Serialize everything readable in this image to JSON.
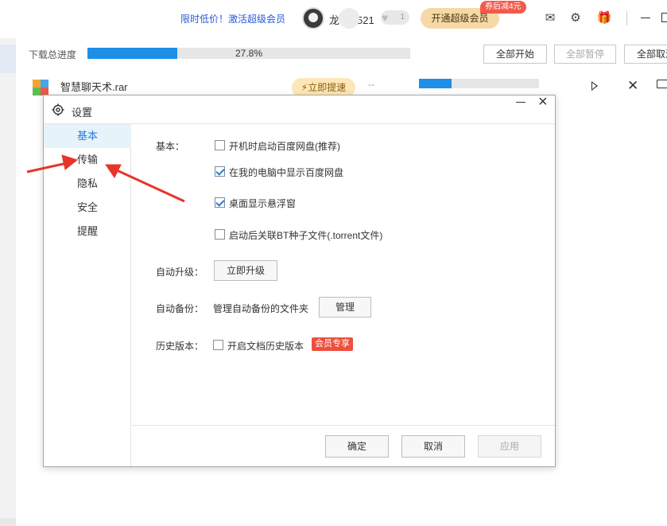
{
  "topbar": {
    "promo_text": "限时低价！激活超级会员",
    "username": "龙",
    "username_suffix": "521",
    "vip_level": "1",
    "open_vip_label": "开通超级会员",
    "coupon_label": "券后减4元",
    "icons": [
      "mail-icon",
      "settings-icon",
      "gift-icon",
      "minimize-icon",
      "maximize-icon"
    ]
  },
  "download": {
    "total_label": "下载总进度",
    "total_progress_text": "27.8%",
    "total_progress": 0.278,
    "buttons": {
      "start_all": "全部开始",
      "pause_all": "全部暂停",
      "cancel_all": "全部取消"
    },
    "file": {
      "name": "智慧聊天术.rar",
      "speedup_label": "⚡立即提速",
      "status": "--",
      "progress": 0.27
    }
  },
  "dialog": {
    "title": "设置",
    "nav": [
      "基本",
      "传输",
      "隐私",
      "安全",
      "提醒"
    ],
    "active_nav": "基本",
    "basic": {
      "label": "基本：",
      "options": [
        {
          "text": "开机时启动百度网盘(推荐)",
          "checked": false
        },
        {
          "text": "在我的电脑中显示百度网盘",
          "checked": true
        },
        {
          "text": "桌面显示悬浮窗",
          "checked": true
        },
        {
          "text": "启动后关联BT种子文件(.torrent文件)",
          "checked": false
        }
      ]
    },
    "auto_upgrade": {
      "label": "自动升级：",
      "button": "立即升级"
    },
    "auto_backup": {
      "label": "自动备份：",
      "text": "管理自动备份的文件夹",
      "button": "管理"
    },
    "history": {
      "label": "历史版本：",
      "option": "开启文档历史版本",
      "checked": false,
      "vip_tag": "会员专享"
    },
    "footer": {
      "ok": "确定",
      "cancel": "取消",
      "apply": "应用"
    }
  },
  "colors": {
    "accent": "#1e8fe6",
    "annotation": "#e8352b",
    "vip_gold": "#f5d9a6",
    "vip_red": "#ee4f3d"
  }
}
